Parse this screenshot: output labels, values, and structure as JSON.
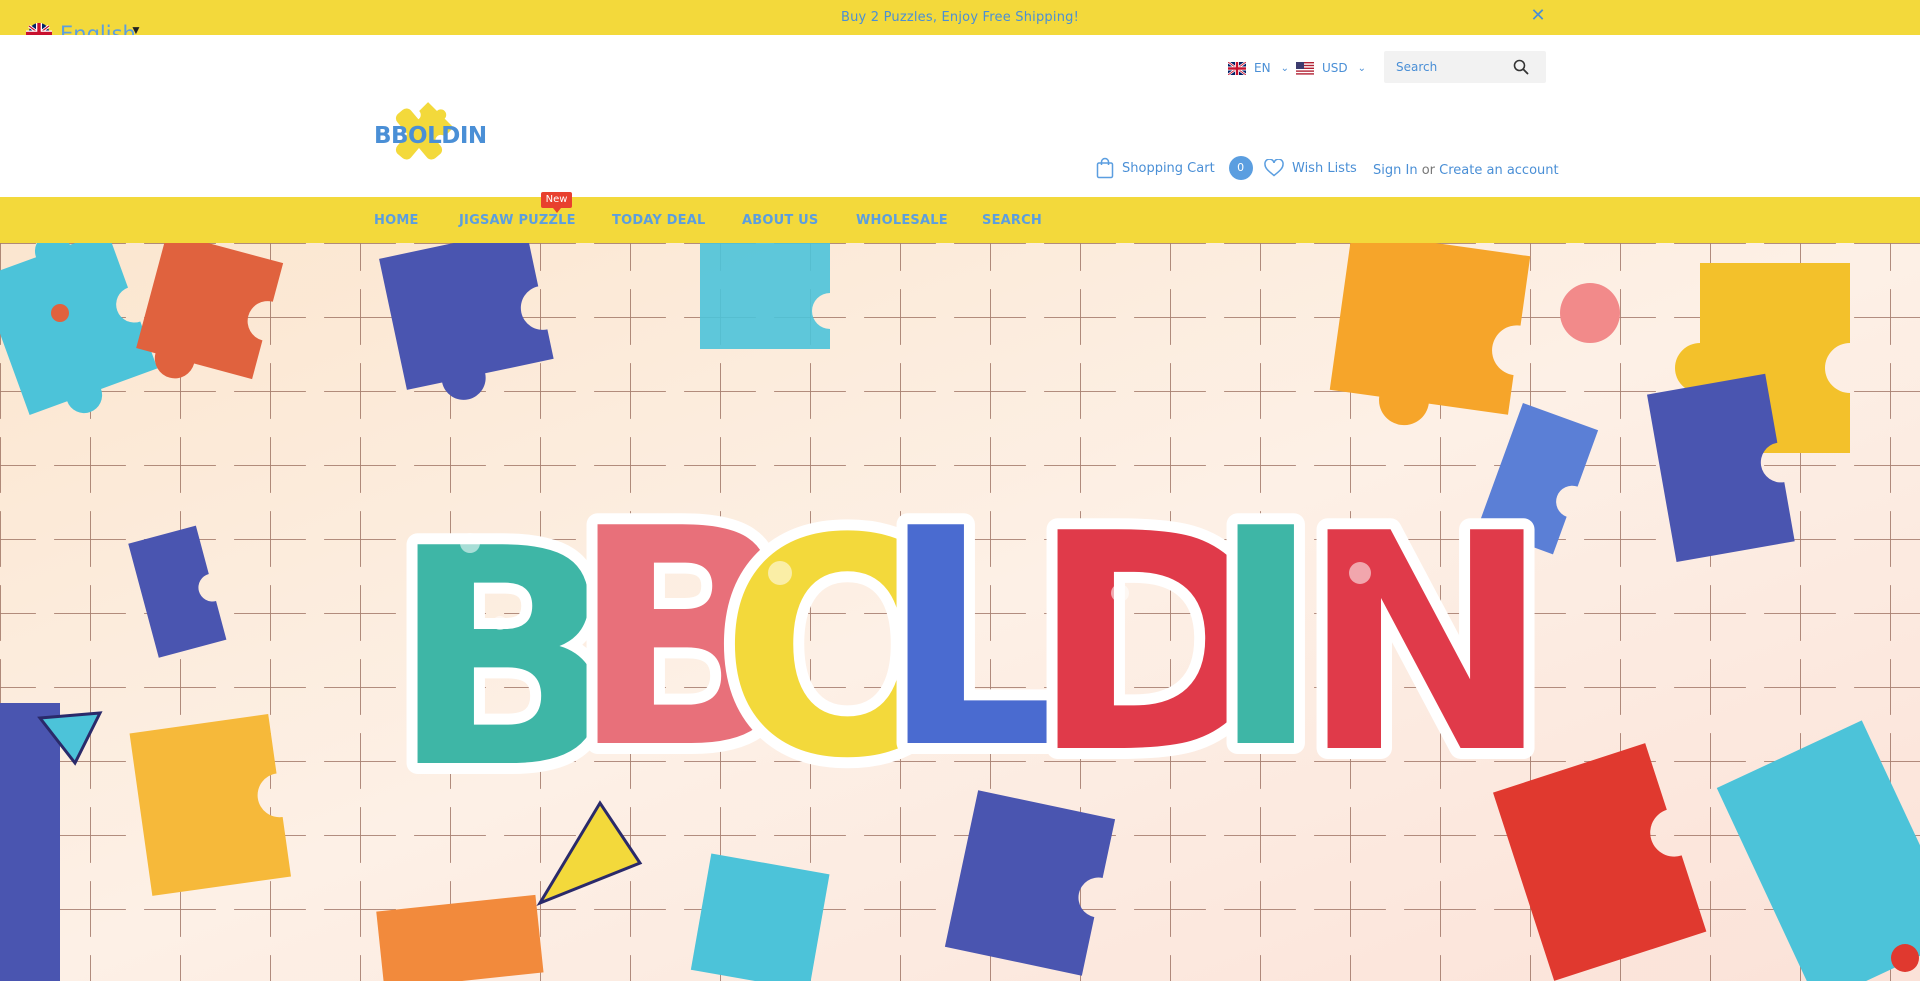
{
  "announcement": {
    "text": "Buy 2 Puzzles, Enjoy Free Shipping!",
    "close_icon": "close-icon"
  },
  "translator": {
    "label": "English",
    "flag_icon": "uk-flag-icon",
    "caret_icon": "caret-down-icon"
  },
  "utility": {
    "language": {
      "code": "EN",
      "flag_icon": "uk-flag-icon"
    },
    "currency": {
      "code": "USD",
      "flag_icon": "us-flag-icon"
    },
    "search": {
      "placeholder": "Search",
      "icon": "search-icon"
    }
  },
  "brand": {
    "logo_text": "BBOLDIN"
  },
  "header": {
    "cart_label": "Shopping Cart",
    "cart_count": "0",
    "wishlist_label": "Wish Lists",
    "sign_in": "Sign In",
    "or": "or",
    "create_account": "Create an account"
  },
  "nav": {
    "items": [
      {
        "label": "Home"
      },
      {
        "label": "Jigsaw Puzzle"
      },
      {
        "label": "Today Deal"
      },
      {
        "label": "About Us"
      },
      {
        "label": "Wholesale"
      },
      {
        "label": "Search"
      }
    ],
    "new_badge": "New"
  },
  "hero": {
    "banner_text": "BBOLDIN"
  },
  "colors": {
    "accent_yellow": "#f3d93b",
    "link_blue": "#4a8fd6",
    "badge_red": "#e8402e"
  }
}
